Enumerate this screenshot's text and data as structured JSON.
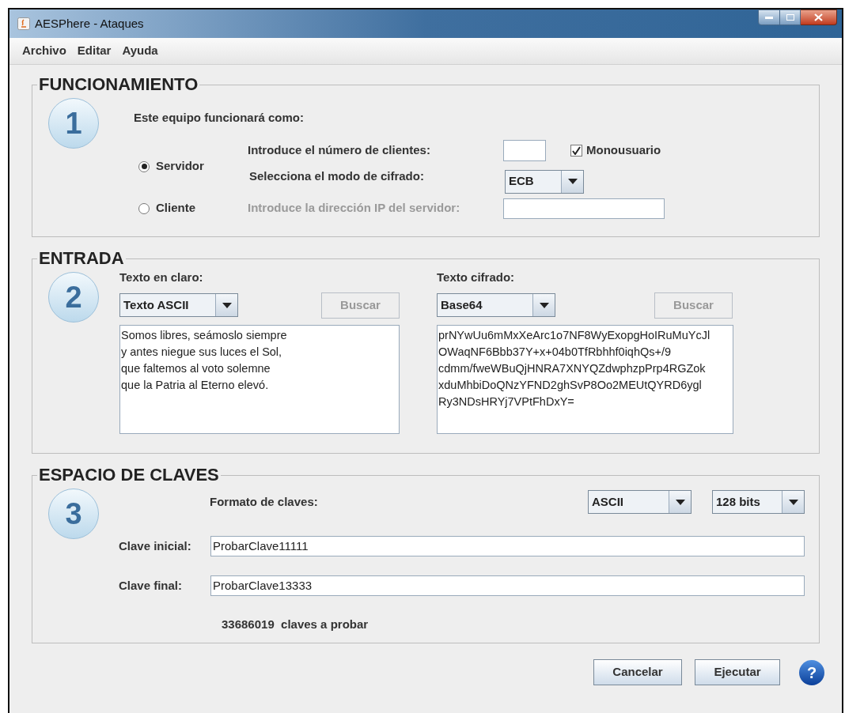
{
  "window": {
    "title": "AESPhere - Ataques"
  },
  "menu": [
    "Archivo",
    "Editar",
    "Ayuda"
  ],
  "funcionamiento": {
    "title": "FUNCIONAMIENTO",
    "step": "1",
    "prompt": "Este equipo funcionará como:",
    "modes": [
      {
        "label": "Servidor",
        "selected": true
      },
      {
        "label": "Cliente",
        "selected": false
      }
    ],
    "clients_label": "Introduce el número de clientes:",
    "monousuario": {
      "label": "Monousuario",
      "checked": true
    },
    "cipher_mode_label": "Selecciona el modo de cifrado:",
    "cipher_mode": "ECB",
    "server_ip_label": {
      "text": "Introduce la dirección IP del servidor:",
      "disabled": true
    }
  },
  "entrada": {
    "title": "ENTRADA",
    "step": "2",
    "columns": [
      {
        "label": "Texto en claro:",
        "format": "Texto ASCII",
        "search": {
          "label": "Buscar",
          "disabled": true
        },
        "text": "Somos libres, seámoslo siempre\ny antes niegue sus luces el Sol,\nque faltemos al voto solemne\nque la Patria al Eterno elevó."
      },
      {
        "label": "Texto cifrado:",
        "format": "Base64",
        "search": {
          "label": "Buscar",
          "disabled": true
        },
        "text": "prNYwUu6mMxXeArc1o7NF8WyExopgHoIRuMuYcJl\nOWaqNF6Bbb37Y+x+04b0TfRbhhf0iqhQs+/9\ncdmm/fweWBuQjHNRA7XNYQZdwphzpPrp4RGZok\nxduMhbiDoQNzYFND2ghSvP8Oo2MEUtQYRD6ygl\nRy3NDsHRYj7VPtFhDxY="
      }
    ]
  },
  "claves": {
    "title": "ESPACIO DE CLAVES",
    "step": "3",
    "format_label": "Formato de claves:",
    "format": "ASCII",
    "size": "128 bits",
    "start": {
      "label": "Clave inicial:",
      "value": "ProbarClave11111"
    },
    "end": {
      "label": "Clave final:",
      "value": "ProbarClave13333"
    },
    "count": "33686019  claves a probar"
  },
  "buttons": [
    {
      "label": "Cancelar"
    },
    {
      "label": "Ejecutar"
    }
  ],
  "help": "?"
}
